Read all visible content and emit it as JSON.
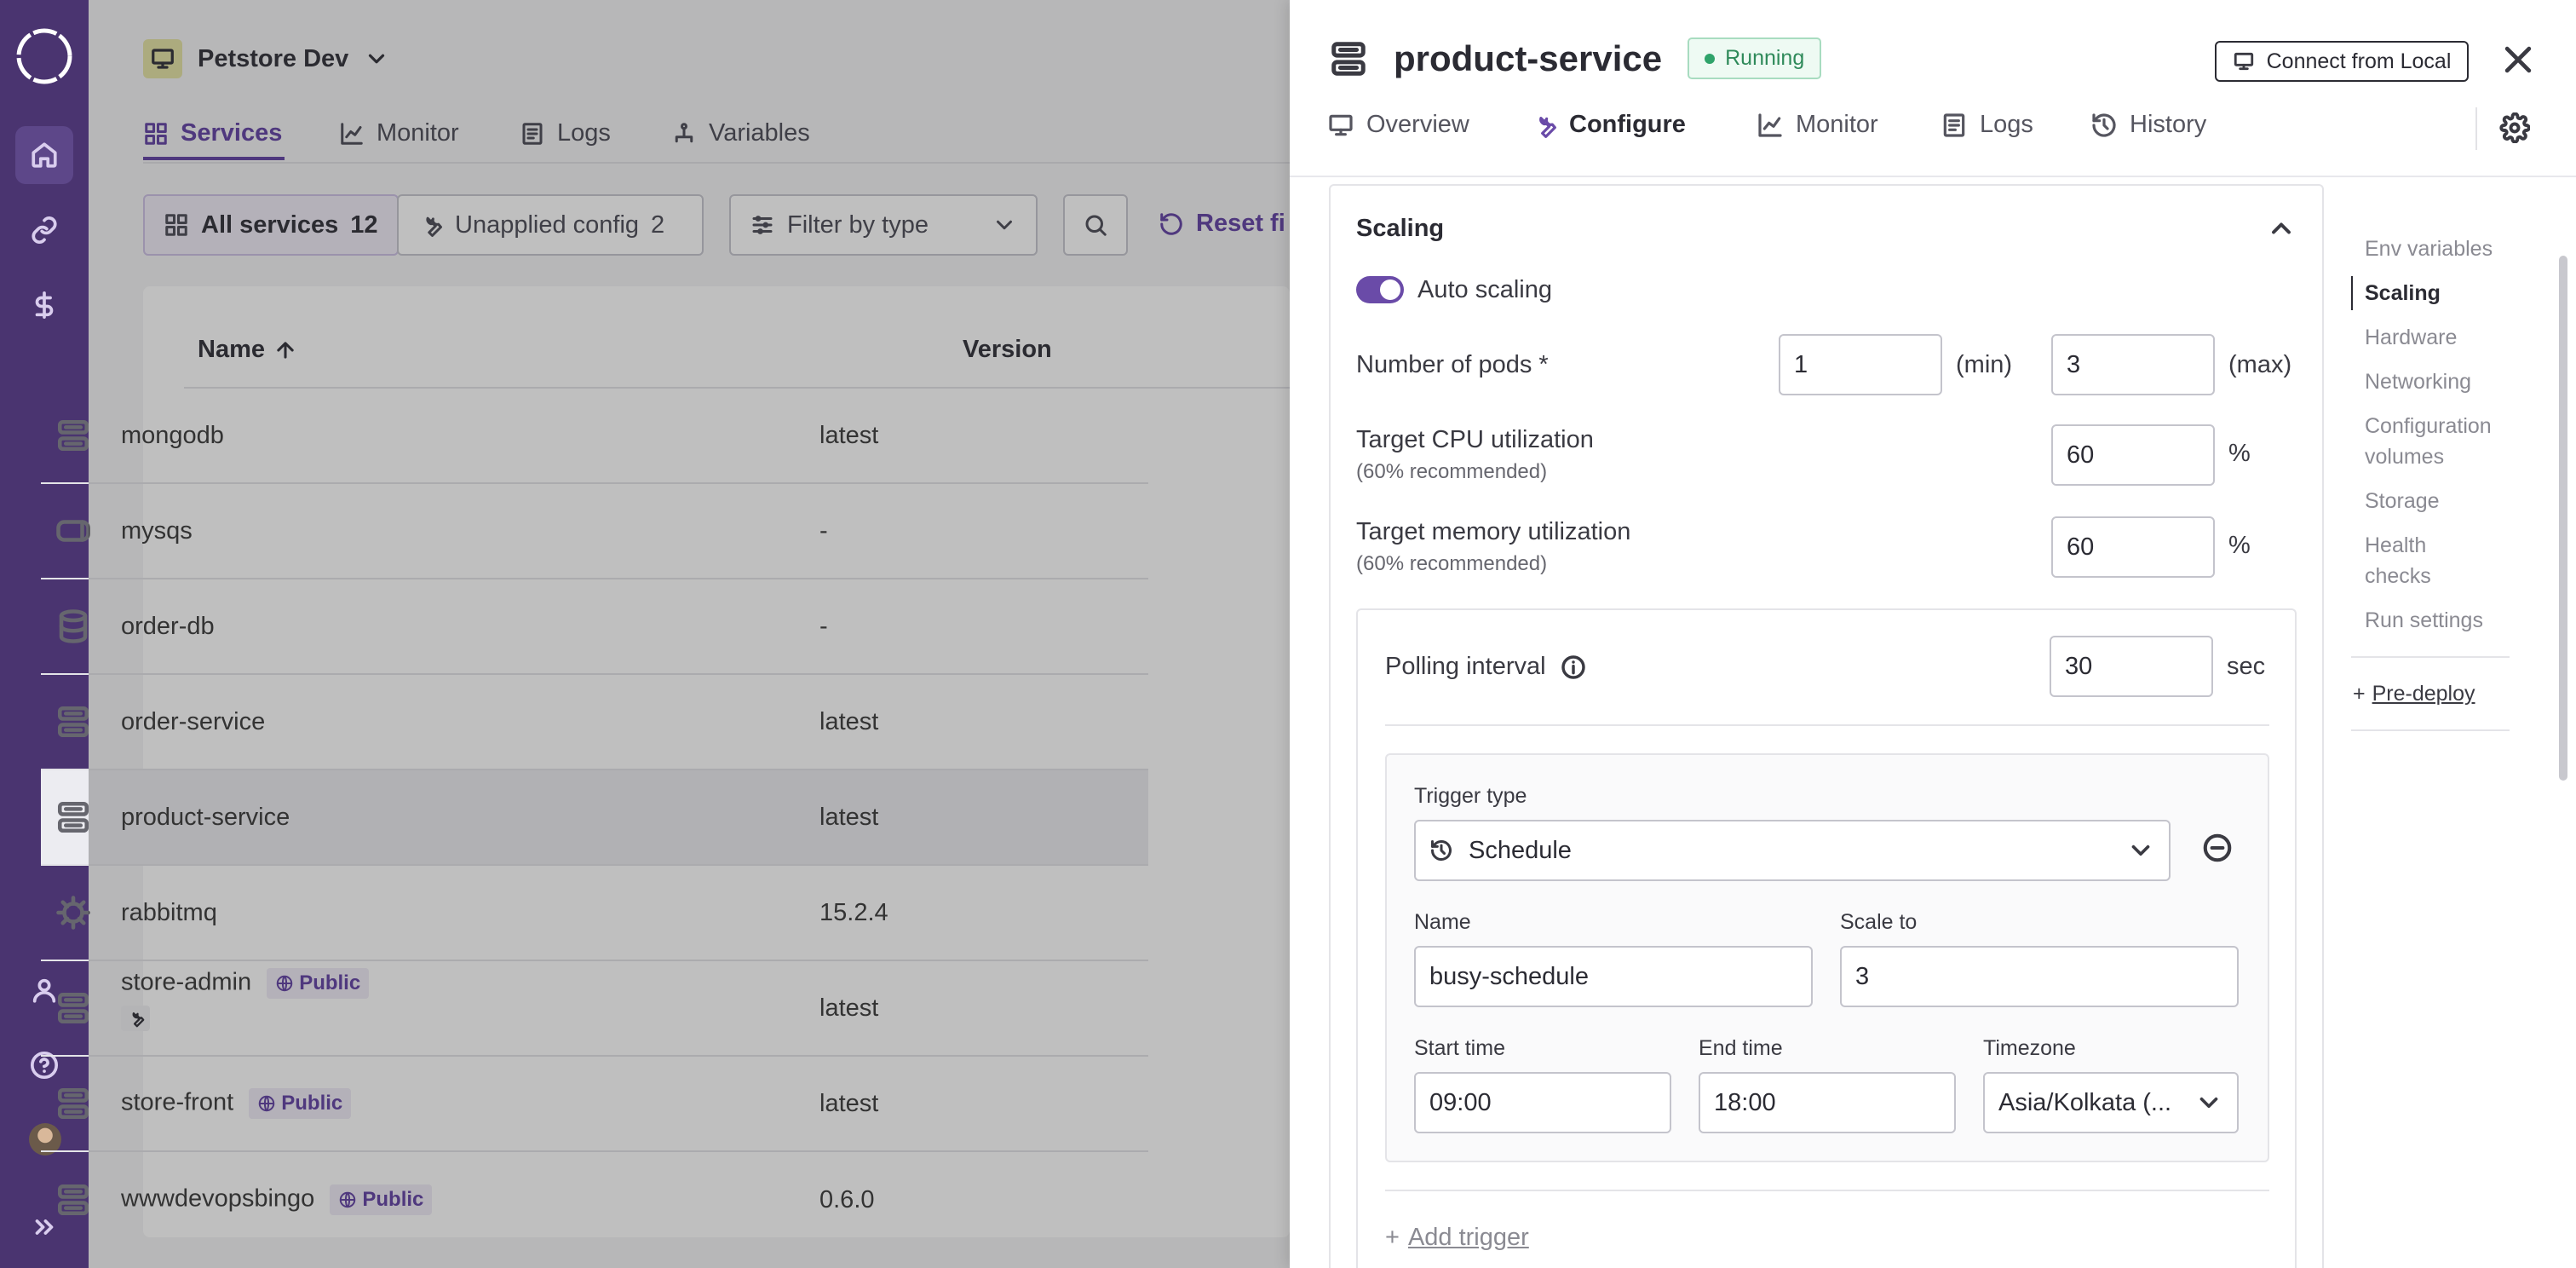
{
  "sidebar": {
    "items": [
      "home-icon",
      "link-icon",
      "dollar-icon"
    ],
    "bottom": [
      "user-icon",
      "help-icon",
      "avatar",
      "expand-icon"
    ]
  },
  "environment": {
    "name": "Petstore Dev"
  },
  "page_tabs": {
    "services": "Services",
    "monitor": "Monitor",
    "logs": "Logs",
    "variables": "Variables"
  },
  "filters": {
    "all_services_label": "All services",
    "all_services_count": "12",
    "unapplied_label": "Unapplied config",
    "unapplied_count": "2",
    "type_placeholder": "Filter by type",
    "reset_label": "Reset fi"
  },
  "table": {
    "col_name": "Name",
    "col_version": "Version",
    "public_label": "Public",
    "rows": [
      {
        "name": "mongodb",
        "version": "latest"
      },
      {
        "name": "mysqs",
        "version": "-"
      },
      {
        "name": "order-db",
        "version": "-"
      },
      {
        "name": "order-service",
        "version": "latest"
      },
      {
        "name": "product-service",
        "version": "latest"
      },
      {
        "name": "rabbitmq",
        "version": "15.2.4"
      },
      {
        "name": "store-admin",
        "version": "latest"
      },
      {
        "name": "store-front",
        "version": "latest"
      },
      {
        "name": "wwwdevopsbingo",
        "version": "0.6.0"
      }
    ]
  },
  "panel": {
    "title": "product-service",
    "status": "Running",
    "connect_label": "Connect from Local",
    "tabs": {
      "overview": "Overview",
      "configure": "Configure",
      "monitor": "Monitor",
      "logs": "Logs",
      "history": "History"
    },
    "scaling": {
      "section_title": "Scaling",
      "auto_scaling_label": "Auto scaling",
      "auto_scaling_on": true,
      "pods_label": "Number of pods *",
      "pods_min": "1",
      "min_label": "(min)",
      "pods_max": "3",
      "max_label": "(max)",
      "cpu_label": "Target CPU utilization",
      "cpu_hint": "(60% recommended)",
      "cpu_value": "60",
      "mem_label": "Target memory utilization",
      "mem_hint": "(60% recommended)",
      "mem_value": "60",
      "percent": "%",
      "polling_label": "Polling interval",
      "polling_value": "30",
      "polling_unit": "sec",
      "trigger_type_label": "Trigger type",
      "trigger_type_value": "Schedule",
      "name_label": "Name",
      "name_value": "busy-schedule",
      "scale_to_label": "Scale to",
      "scale_to_value": "3",
      "start_label": "Start time",
      "start_value": "09:00",
      "end_label": "End time",
      "end_value": "18:00",
      "tz_label": "Timezone",
      "tz_value": "Asia/Kolkata (...",
      "add_trigger": "Add trigger"
    },
    "right_nav": {
      "env": "Env variables",
      "scaling": "Scaling",
      "hardware": "Hardware",
      "networking": "Networking",
      "config1": "Configuration",
      "config2": "volumes",
      "storage": "Storage",
      "health1": "Health",
      "health2": "checks",
      "run": "Run settings",
      "predeploy": "Pre-deploy"
    }
  }
}
